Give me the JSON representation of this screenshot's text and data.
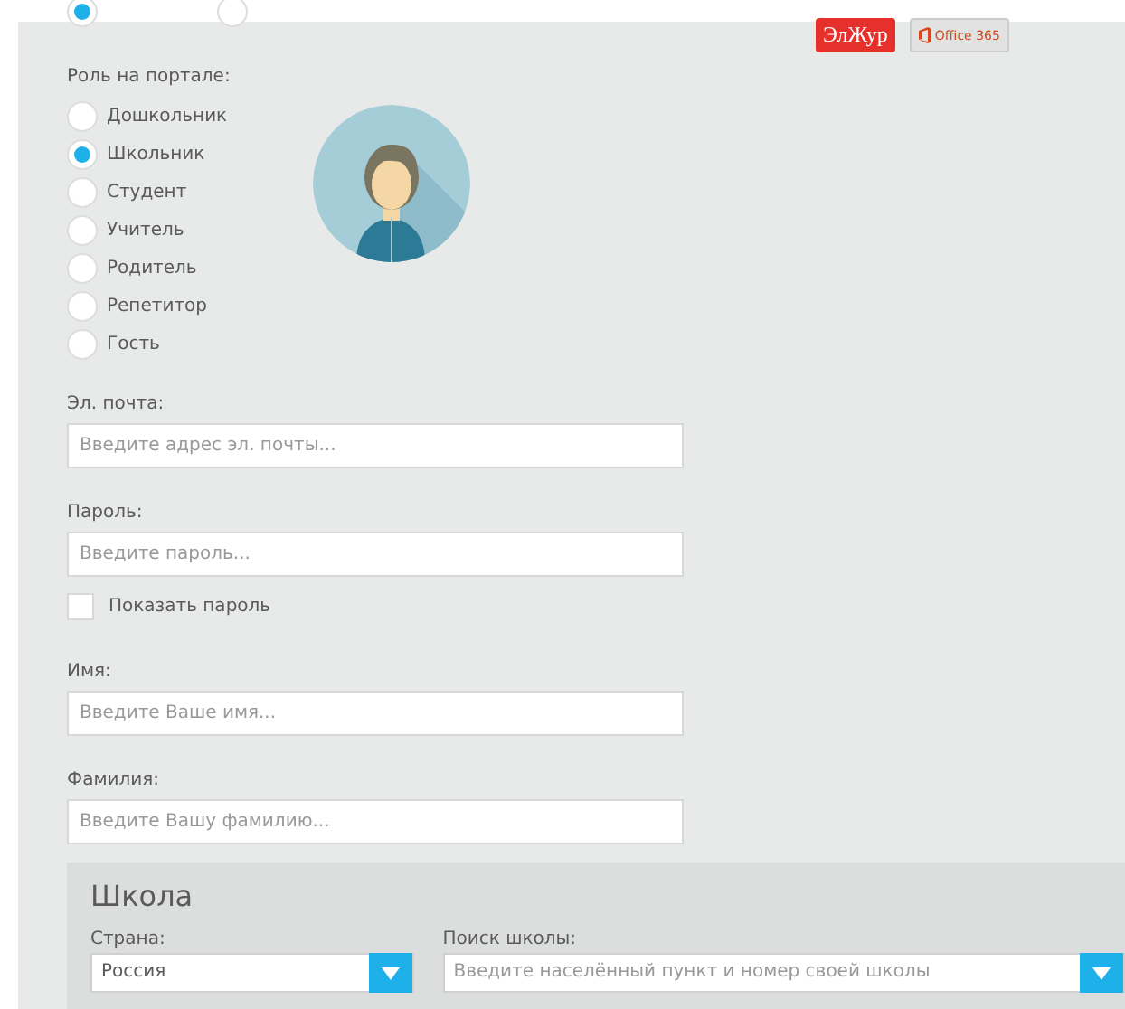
{
  "gender_options": [
    {
      "selected": true
    },
    {
      "selected": false
    }
  ],
  "service_buttons": [
    {
      "kind": "eljur",
      "label": "ЭлЖур"
    },
    {
      "kind": "office",
      "label": "Office 365"
    }
  ],
  "role": {
    "label": "Роль на портале:",
    "options": [
      {
        "label": "Дошкольник",
        "selected": false
      },
      {
        "label": "Школьник",
        "selected": true
      },
      {
        "label": "Студент",
        "selected": false
      },
      {
        "label": "Учитель",
        "selected": false
      },
      {
        "label": "Родитель",
        "selected": false
      },
      {
        "label": "Репетитор",
        "selected": false
      },
      {
        "label": "Гость",
        "selected": false
      }
    ]
  },
  "fields": [
    {
      "kind": "input",
      "label": "Эл. почта:",
      "placeholder": "Введите адрес эл. почты..."
    },
    {
      "kind": "input",
      "label": "Пароль:",
      "placeholder": "Введите пароль..."
    },
    {
      "kind": "checkbox",
      "label": "Показать пароль",
      "checked": false
    },
    {
      "kind": "input",
      "label": "Имя:",
      "placeholder": "Введите Ваше имя..."
    },
    {
      "kind": "input",
      "label": "Фамилия:",
      "placeholder": "Введите Вашу фамилию..."
    }
  ],
  "school": {
    "title": "Школа",
    "country": {
      "label": "Страна:",
      "value": "Россия"
    },
    "search": {
      "label": "Поиск школы:",
      "placeholder": "Введите населённый пункт и номер своей школы"
    }
  }
}
